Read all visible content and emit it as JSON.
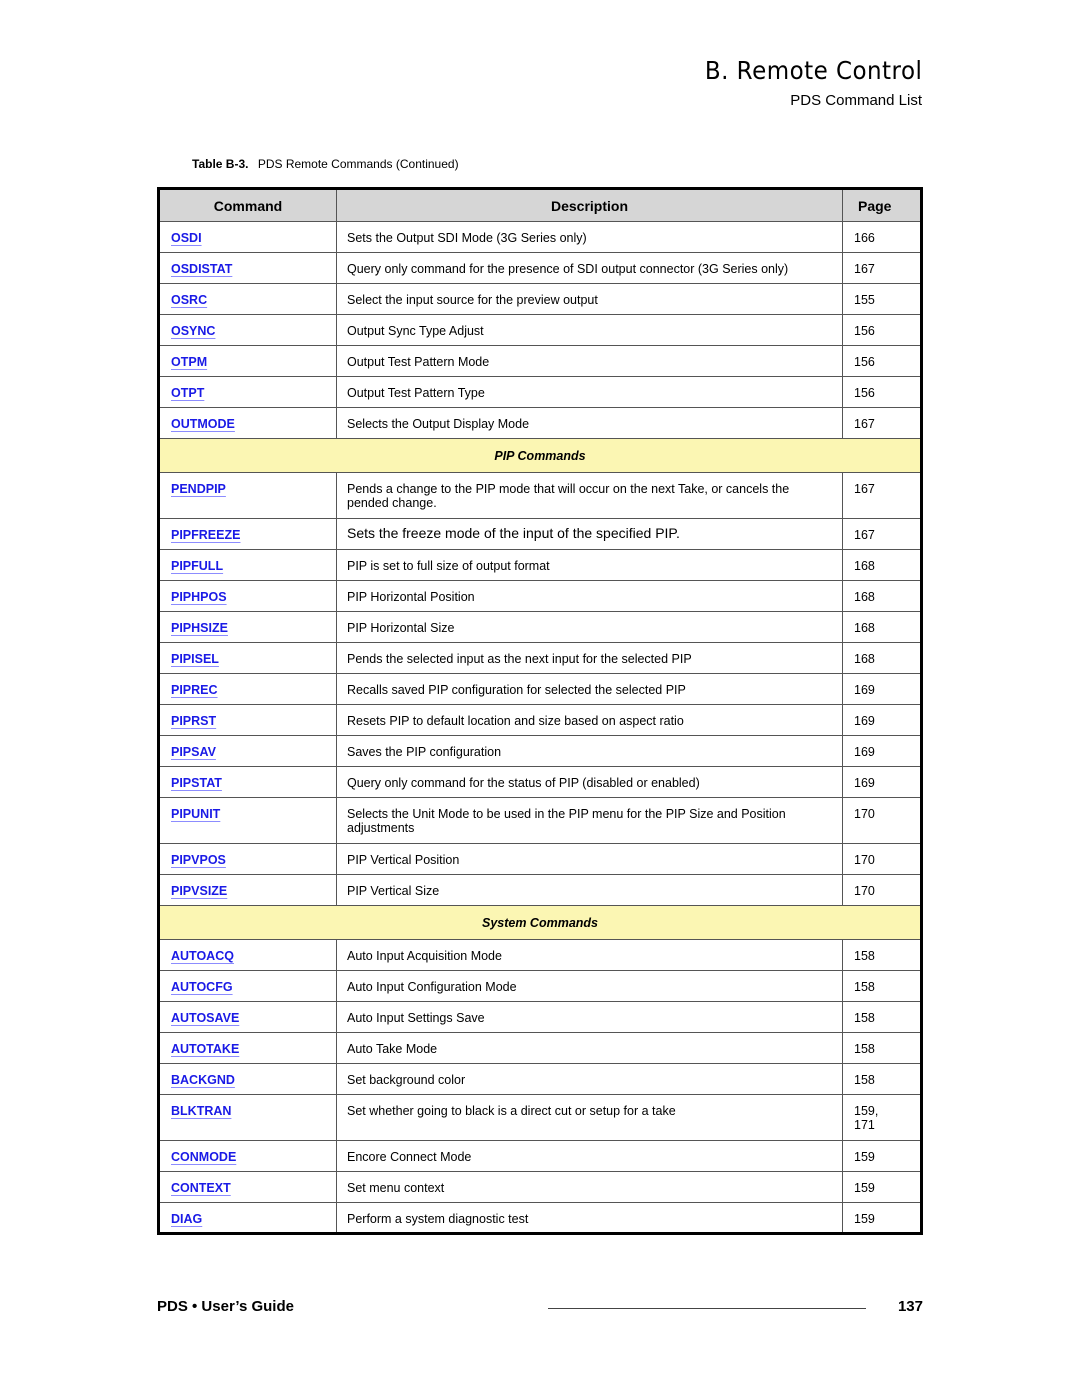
{
  "header": {
    "chapter": "B.  Remote Control",
    "section": "PDS Command List"
  },
  "caption": {
    "label": "Table B-3.",
    "text": "PDS Remote Commands  (Continued)"
  },
  "table": {
    "headers": {
      "command": "Command",
      "description": "Description",
      "page": "Page"
    },
    "rows_output": [
      {
        "command": "OSDI",
        "description": "Sets the Output SDI Mode (3G Series only)",
        "page": "166"
      },
      {
        "command": "OSDISTAT",
        "description": "Query only command for the presence of SDI output connector (3G Series only)",
        "page": "167"
      },
      {
        "command": "OSRC",
        "description": "Select the input source for the preview output",
        "page": "155"
      },
      {
        "command": "OSYNC",
        "description": "Output Sync Type Adjust",
        "page": "156"
      },
      {
        "command": "OTPM",
        "description": "Output Test Pattern Mode",
        "page": "156"
      },
      {
        "command": "OTPT",
        "description": "Output Test Pattern Type",
        "page": "156"
      },
      {
        "command": "OUTMODE",
        "description": "Selects the Output Display Mode",
        "page": "167"
      }
    ],
    "section_pip": "PIP Commands",
    "rows_pip": [
      {
        "command": "PENDPIP",
        "description": "Pends a change to the PIP mode that will occur on the next Take, or cancels the pended change.",
        "page": "167"
      },
      {
        "command": "PIPFREEZE",
        "description": "Sets the freeze mode of the input of the specified PIP.",
        "page": "167"
      },
      {
        "command": "PIPFULL",
        "description": "PIP is set to full size of output format",
        "page": "168"
      },
      {
        "command": "PIPHPOS",
        "description": "PIP Horizontal Position",
        "page": "168"
      },
      {
        "command": "PIPHSIZE",
        "description": "PIP Horizontal Size",
        "page": "168"
      },
      {
        "command": "PIPISEL",
        "description": "Pends the selected input as the next input for the selected PIP",
        "page": "168"
      },
      {
        "command": "PIPREC",
        "description": "Recalls saved PIP configuration for selected the selected PIP",
        "page": "169"
      },
      {
        "command": "PIPRST",
        "description": "Resets PIP to default location and size based on aspect ratio",
        "page": "169"
      },
      {
        "command": "PIPSAV",
        "description": "Saves the PIP configuration",
        "page": "169"
      },
      {
        "command": "PIPSTAT",
        "description": "Query only command for the status of PIP (disabled or enabled)",
        "page": "169"
      },
      {
        "command": "PIPUNIT",
        "description": "Selects the Unit Mode to be used in the PIP menu for the PIP Size and Position adjustments",
        "page": "170"
      },
      {
        "command": "PIPVPOS",
        "description": "PIP Vertical Position",
        "page": "170"
      },
      {
        "command": "PIPVSIZE",
        "description": "PIP Vertical Size",
        "page": "170"
      }
    ],
    "section_system": "System Commands",
    "rows_system": [
      {
        "command": "AUTOACQ",
        "description": "Auto Input Acquisition Mode",
        "page": "158"
      },
      {
        "command": "AUTOCFG",
        "description": "Auto Input Configuration Mode",
        "page": "158"
      },
      {
        "command": "AUTOSAVE",
        "description": "Auto Input Settings Save",
        "page": "158"
      },
      {
        "command": "AUTOTAKE",
        "description": "Auto Take Mode",
        "page": "158"
      },
      {
        "command": "BACKGND",
        "description": "Set background color",
        "page": "158"
      },
      {
        "command": "BLKTRAN",
        "description": "Set whether going to black is a direct cut or setup for a take",
        "page": "159, 171"
      },
      {
        "command": "CONMODE",
        "description": "Encore Connect Mode",
        "page": "159"
      },
      {
        "command": "CONTEXT",
        "description": "Set menu context",
        "page": "159"
      },
      {
        "command": "DIAG",
        "description": "Perform a system diagnostic test",
        "page": "159"
      }
    ]
  },
  "footer": {
    "guide": "PDS  •  User’s Guide",
    "page_number": "137"
  }
}
